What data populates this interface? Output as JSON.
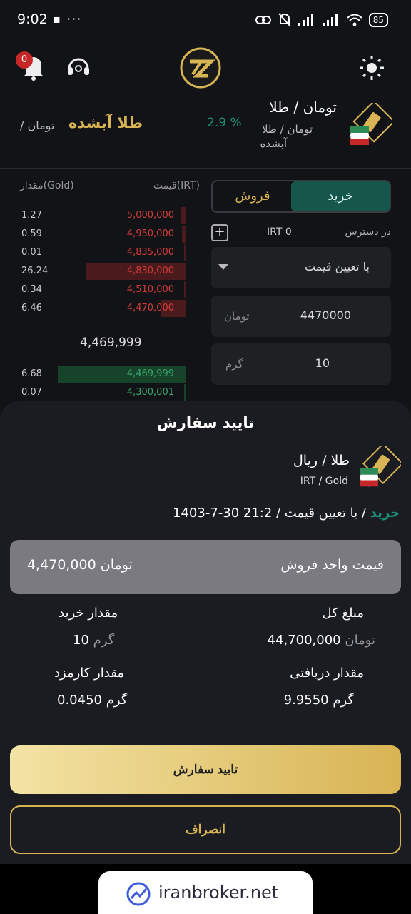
{
  "status_bar": {
    "time": "9:02",
    "left_icons": "▪ ···",
    "battery": "85"
  },
  "app_bar": {
    "notification_count": "0"
  },
  "pair_header": {
    "title": "تومان / طلا",
    "subtitle_line1": "تومان / طلا",
    "subtitle_line2": "آبشده",
    "change_pct": "2.9 %",
    "gold_title": "طلا آبشده",
    "unit_tag": "/ تومان"
  },
  "orderbook": {
    "header_price": "قیمت(IRT)",
    "header_amount": "مقدار(Gold)",
    "asks": [
      {
        "amount": "1.27",
        "price": "5,000,000",
        "depth": 0.03
      },
      {
        "amount": "0.59",
        "price": "4,950,000",
        "depth": 0.02
      },
      {
        "amount": "0.01",
        "price": "4,835,000",
        "depth": 0.0
      },
      {
        "amount": "26.24",
        "price": "4,830,000",
        "depth": 0.61
      },
      {
        "amount": "0.34",
        "price": "4,510,000",
        "depth": 0.01
      },
      {
        "amount": "6.46",
        "price": "4,470,000",
        "depth": 0.15
      }
    ],
    "mid_price": "4,469,999",
    "bids": [
      {
        "amount": "6.68",
        "price": "4,469,999",
        "depth": 0.78
      },
      {
        "amount": "0.07",
        "price": "4,300,001",
        "depth": 0.01
      }
    ]
  },
  "trade_panel": {
    "buy_tab": "خرید",
    "sell_tab": "فروش",
    "available_label": "در دسترس",
    "available_value": "IRT 0",
    "plus": "+",
    "order_type": "با تعیین قیمت",
    "price_value": "4470000",
    "price_unit": "تومان",
    "amount_value": "10",
    "amount_unit": "گرم"
  },
  "confirm_sheet": {
    "title": "تایید سفارش",
    "pair_name": "طلا / ریال",
    "pair_code": "IRT / Gold",
    "side": "خرید",
    "desc": " / با تعیین قیمت / 21:2 30-7-1403",
    "unit_price_label": "قیمت واحد فروش",
    "unit_price_value": "4,470,000 تومان",
    "total_label": "مبلغ کل",
    "total_value": "44,700,000",
    "total_unit": "تومان",
    "buy_amount_label": "مقدار خرید",
    "buy_amount_value": "10",
    "buy_amount_unit": "گرم",
    "received_label": "مقدار دریافتی",
    "received_value": "9.9550 گرم",
    "fee_label": "مقدار کارمزد",
    "fee_value": "0.0450 گرم",
    "confirm_button": "تایید سفارش",
    "cancel_button": "انصراف"
  },
  "watermark": {
    "text": "iranbroker.net"
  },
  "colors": {
    "accent_gold": "#d8b454",
    "buy_green": "#15584b",
    "ask_red": "#d33b3b",
    "bid_green": "#3aa56a"
  }
}
